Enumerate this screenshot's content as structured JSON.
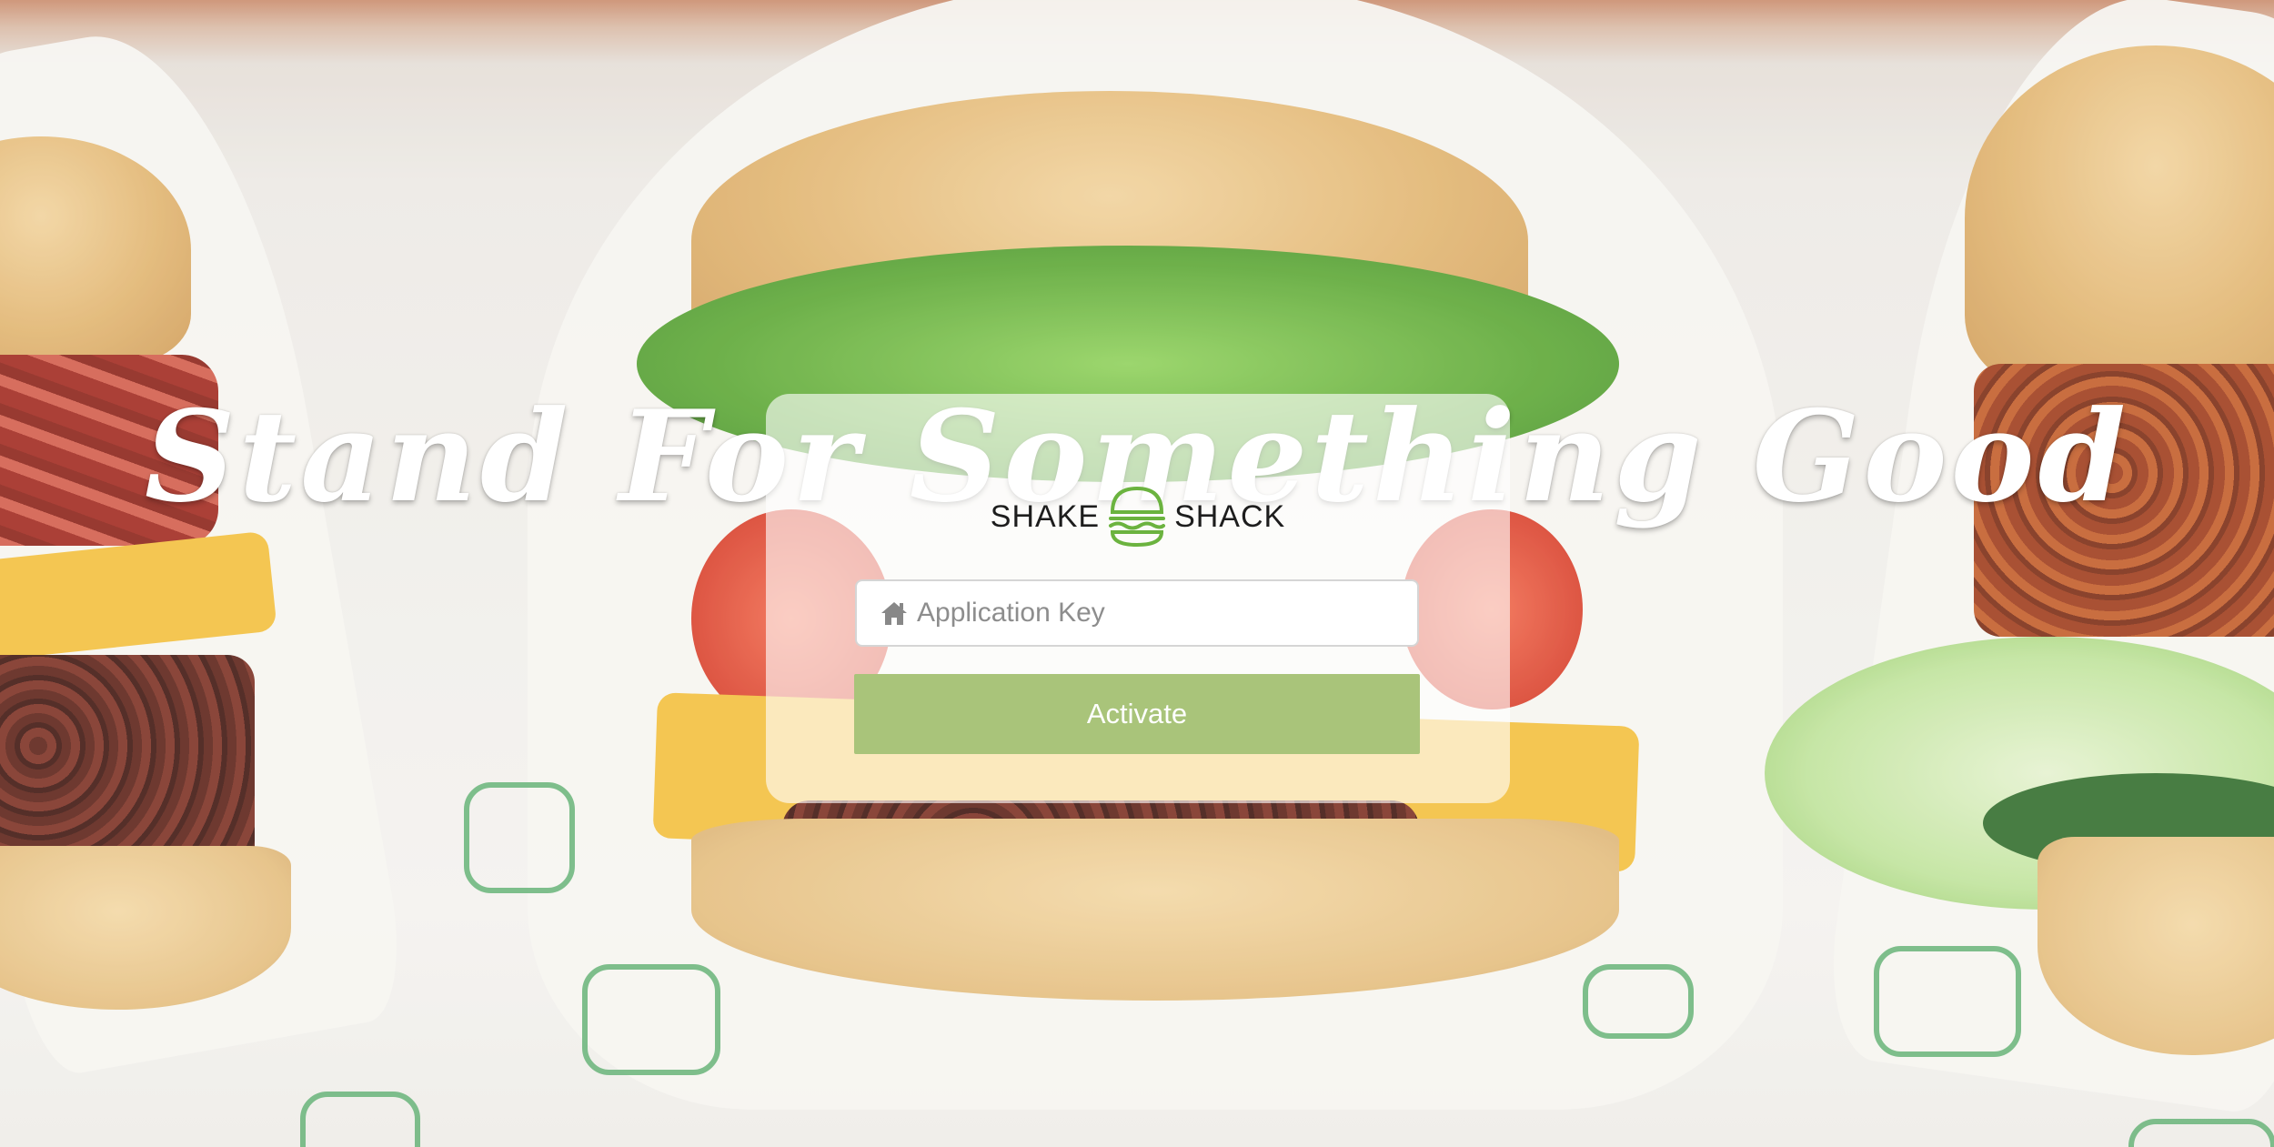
{
  "background": {
    "image_subject": "burgers",
    "primary_overlay_color": "#ffffff"
  },
  "headline": {
    "text": "Stand For Something Good"
  },
  "card": {
    "logo": {
      "left_word": "SHAKE",
      "right_word": "SHACK",
      "icon": "burger-icon",
      "accent": "#6bb33f"
    },
    "key_field": {
      "icon": "home-icon",
      "placeholder": "Application Key",
      "value": ""
    },
    "activate_button": {
      "label": "Activate",
      "color": "#a9c47a"
    }
  }
}
